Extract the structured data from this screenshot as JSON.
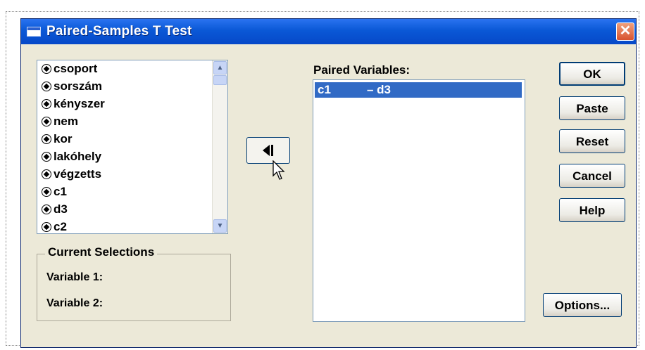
{
  "window": {
    "title": "Paired-Samples T Test",
    "close_label": "✕"
  },
  "variables": {
    "items": [
      "csoport",
      "sorszám",
      "kényszer",
      "nem",
      "kor",
      "lakóhely",
      "végzetts",
      "c1",
      "d3",
      "c2"
    ]
  },
  "current_selections": {
    "label": "Current Selections",
    "variable1_label": "Variable 1:",
    "variable2_label": "Variable 2:"
  },
  "paired": {
    "label": "Paired Variables:",
    "rows": [
      {
        "var1": "c1",
        "var2": "– d3"
      }
    ]
  },
  "buttons": {
    "ok": "OK",
    "paste": "Paste",
    "reset": "Reset",
    "cancel": "Cancel",
    "help": "Help",
    "options": "Options..."
  },
  "colors": {
    "titlebar": "#0a58d6",
    "selection": "#316ac5",
    "dialog_bg": "#ece9d8"
  }
}
